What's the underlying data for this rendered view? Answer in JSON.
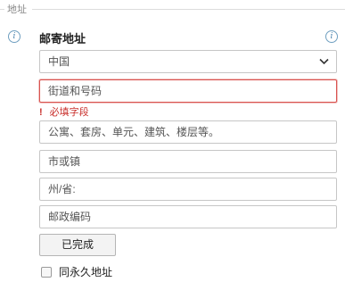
{
  "fieldset": {
    "legend": "地址"
  },
  "section": {
    "title": "邮寄地址"
  },
  "info_icons": {
    "glyph": "i"
  },
  "country": {
    "selected": "中国"
  },
  "street": {
    "placeholder": "街道和号码"
  },
  "error": {
    "marker": "!",
    "message": "必填字段"
  },
  "address_line2": {
    "placeholder": "公寓、套房、单元、建筑、楼层等。"
  },
  "city": {
    "placeholder": "市或镇"
  },
  "state": {
    "placeholder": "州/省:"
  },
  "postal": {
    "placeholder": "邮政编码"
  },
  "buttons": {
    "done": "已完成"
  },
  "permanent": {
    "label": "同永久地址",
    "checked": false
  },
  "colors": {
    "error": "#d9534f",
    "info": "#4a83ad"
  }
}
